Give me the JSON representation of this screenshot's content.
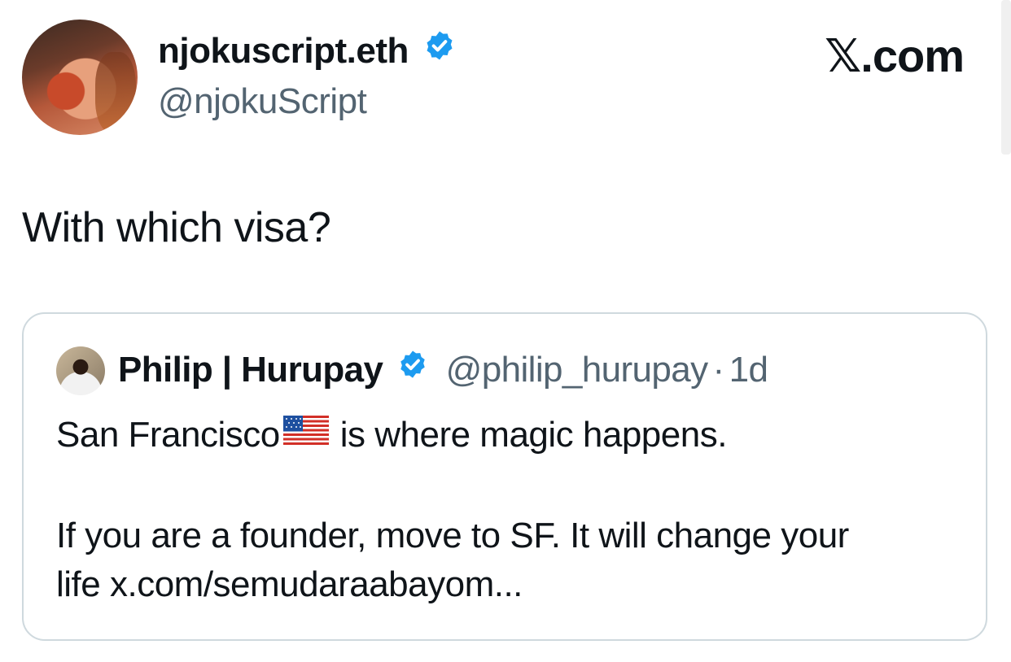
{
  "tweet": {
    "author_name": "njokuscript.eth",
    "author_handle": "@njokuScript",
    "text": "With which visa?"
  },
  "brand": "𝕏.com",
  "quoted_tweet": {
    "author_name": "Philip | Hurupay",
    "author_handle": "@philip_hurupay",
    "separator": "·",
    "time": "1d",
    "line1_before": "San Francisco",
    "line1_after": "is where magic happens.",
    "line2": "If you are a founder, move to SF. It will change your",
    "line3": "life x.com/semudaraabayom..."
  },
  "colors": {
    "verified": "#1d9bf0",
    "secondary_text": "#536471",
    "card_border": "#cfd9de"
  }
}
